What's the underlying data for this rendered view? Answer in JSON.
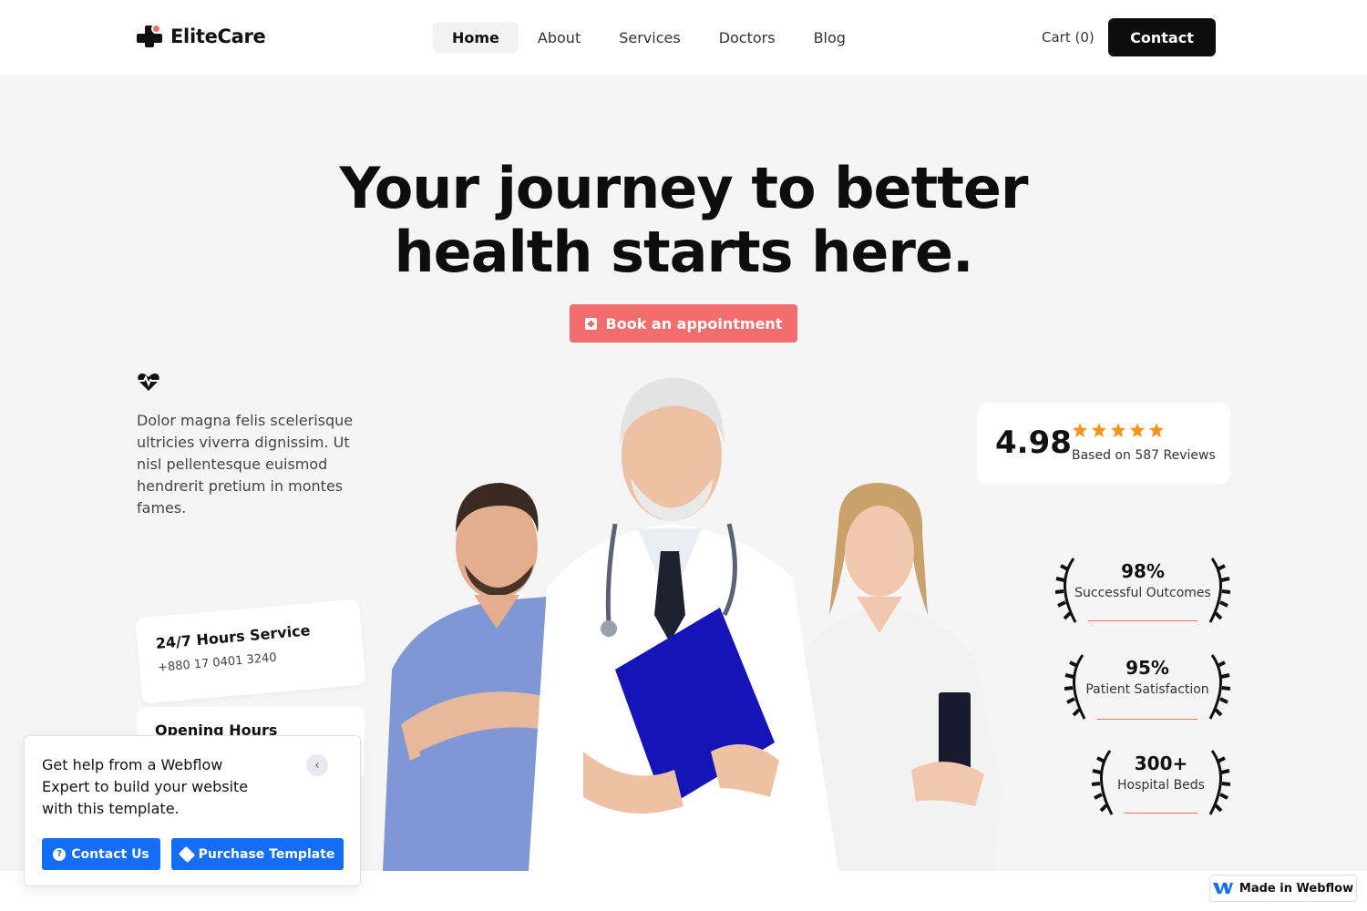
{
  "brand": {
    "name": "EliteCare"
  },
  "nav": {
    "items": [
      {
        "label": "Home",
        "active": true
      },
      {
        "label": "About",
        "active": false
      },
      {
        "label": "Services",
        "active": false
      },
      {
        "label": "Doctors",
        "active": false
      },
      {
        "label": "Blog",
        "active": false
      }
    ],
    "cart_label": "Cart (0)",
    "contact_label": "Contact"
  },
  "hero": {
    "title_line1": "Your journey to better",
    "title_line2": "health starts here.",
    "cta_label": "Book an appointment",
    "cta_color": "#f26d6d",
    "intro": "Dolor magna felis scelerisque ultricies viverra dignissim. Ut nisl pellentesque euismod hendrerit pretium in montes fames."
  },
  "service_card": {
    "title": "24/7 Hours Service",
    "phone": "+880 17 0401 3240"
  },
  "hours_card": {
    "title": "Opening Hours"
  },
  "rating": {
    "score": "4.98",
    "stars": 5,
    "reviews": "Based on 587 Reviews",
    "star_color": "#f7941d"
  },
  "stats": [
    {
      "value": "98%",
      "label": "Successful Outcomes"
    },
    {
      "value": "95%",
      "label": "Patient Satisfaction"
    },
    {
      "value": "300+",
      "label": "Hospital Beds"
    }
  ],
  "webflow_popup": {
    "message": "Get help from a Webflow Expert to build your website with this template.",
    "contact_label": "Contact Us",
    "purchase_label": "Purchase Template",
    "accent": "#146ef5"
  },
  "badge": {
    "label": "Made in Webflow"
  }
}
